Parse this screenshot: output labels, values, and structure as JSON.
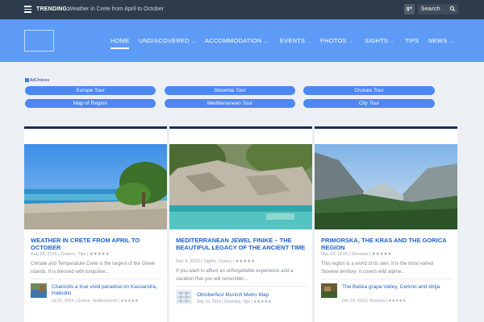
{
  "topbar": {
    "trending_label": "TRENDING:",
    "trending_text": "Weather in Crete from April to October",
    "social_icon": "google-plus-icon",
    "social_label": "g+",
    "search_label": "Search",
    "search_icon": "search-icon"
  },
  "nav": {
    "items": [
      {
        "label": "HOME",
        "active": true,
        "dropdown": false
      },
      {
        "label": "UNDISCOVERED",
        "active": false,
        "dropdown": true
      },
      {
        "label": "ACCOMMODATION",
        "active": false,
        "dropdown": true
      },
      {
        "label": "EVENTS",
        "active": false,
        "dropdown": true
      },
      {
        "label": "PHOTOS",
        "active": false,
        "dropdown": true
      },
      {
        "label": "SIGHTS",
        "active": false,
        "dropdown": true
      },
      {
        "label": "TIPS",
        "active": false,
        "dropdown": false
      },
      {
        "label": "NEWS",
        "active": false,
        "dropdown": true
      }
    ],
    "dropdown_icon": "chevron-down-icon"
  },
  "ad": {
    "choices_label": "AdChoices",
    "links": [
      "Europe Tour",
      "Slovenia Tour",
      "Cruises Tour",
      "Map of Region",
      "Mediterranean Tour",
      "City Tour"
    ]
  },
  "cards": [
    {
      "title": "WEATHER IN CRETE FROM APRIL TO OCTOBER",
      "meta": "Aug 29, 2015 | Greece, Tips | ★★★★★",
      "excerpt": "Climate and Temperature Crete is the largest of the Greek islands. It is blessed with turquoise...",
      "related_title": "Chaniotis a true vivid paradise on Kassandra, Halkidiki",
      "related_meta": "Jul 31, 2014 | Greece, Undiscovered | ★★★★★"
    },
    {
      "title": "MEDITERRANEAN JEWEL FINIKE – THE BEAUTIFUL LEGACY OF THE ANCIENT TIME",
      "meta": "Dec 4, 2015 | Sights, Turkey | ★★★★★",
      "excerpt": "If you want to afford an unforgettable experience and a vacation that you will remember...",
      "related_title": "Oktoberfest Munich Metro Map",
      "related_meta": "Sep 16, 2014 | Germany, Tips | ★★★★★"
    },
    {
      "title": "PRIMORSKA, THE KRAS AND THE GORICA REGION",
      "meta": "Dec 14, 2016 | Slovenia | ★★★★★",
      "excerpt": "This region is a world of its own. It is the most varied Slovene territory: it covers wild alpine...",
      "related_title": "The Baška grapa Valley, Cerkno and Idrija",
      "related_meta": "Dec 14, 2016 | Slovenia | ★★★★★"
    }
  ],
  "colors": {
    "topbar": "#2e3b4c",
    "header": "#5d9bf6",
    "pill": "#4d87f3",
    "title": "#1e62c9",
    "card_border": "#1e2d57",
    "page_bg": "#ecf0f4"
  }
}
